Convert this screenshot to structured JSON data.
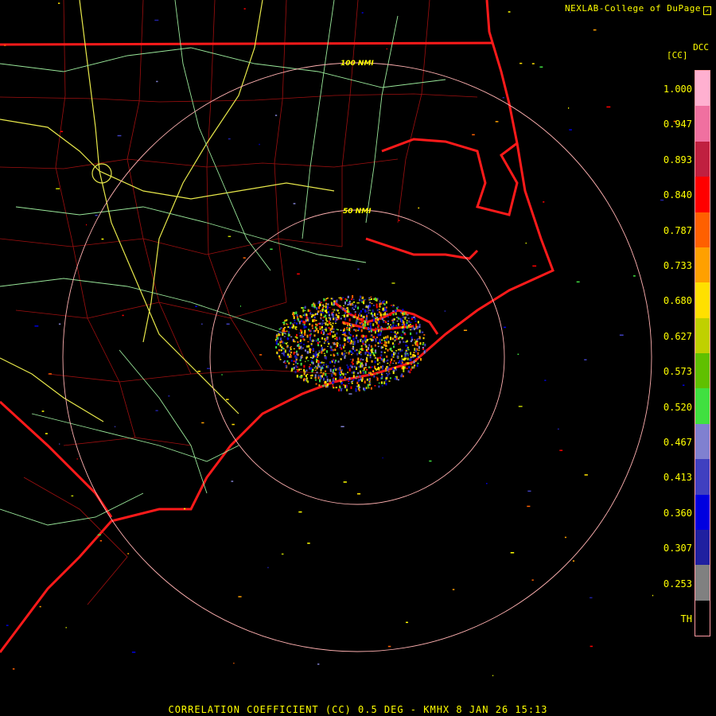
{
  "credit": "NEXLAB-College of DuPage",
  "credit_mark_icon": "cod-logo-icon",
  "legend": {
    "title": "DCC",
    "unit": "[CC]",
    "ticks": [
      "1.000",
      "0.947",
      "0.893",
      "0.840",
      "0.787",
      "0.733",
      "0.680",
      "0.627",
      "0.573",
      "0.520",
      "0.467",
      "0.413",
      "0.360",
      "0.307",
      "0.253",
      "TH"
    ],
    "colors": [
      "#ffb0d0",
      "#f070a0",
      "#c02040",
      "#ff0000",
      "#ff6000",
      "#ffa000",
      "#ffe000",
      "#c0d000",
      "#60c000",
      "#40e040",
      "#8080d0",
      "#4040c0",
      "#0000e0",
      "#2020a0",
      "#808080",
      "#000000"
    ]
  },
  "range_rings": [
    "50 NMI",
    "100 NMI"
  ],
  "footer": "CORRELATION COEFFICIENT (CC) 0.5 DEG - KMHX 8 JAN 26 15:13",
  "colors": {
    "state_border": "#ff1a1a",
    "county": "#b01010",
    "highway_primary": "#e8e84a",
    "highway_secondary": "#9ae89a",
    "ring": "#ffb0b0",
    "text": "#ffff00"
  }
}
